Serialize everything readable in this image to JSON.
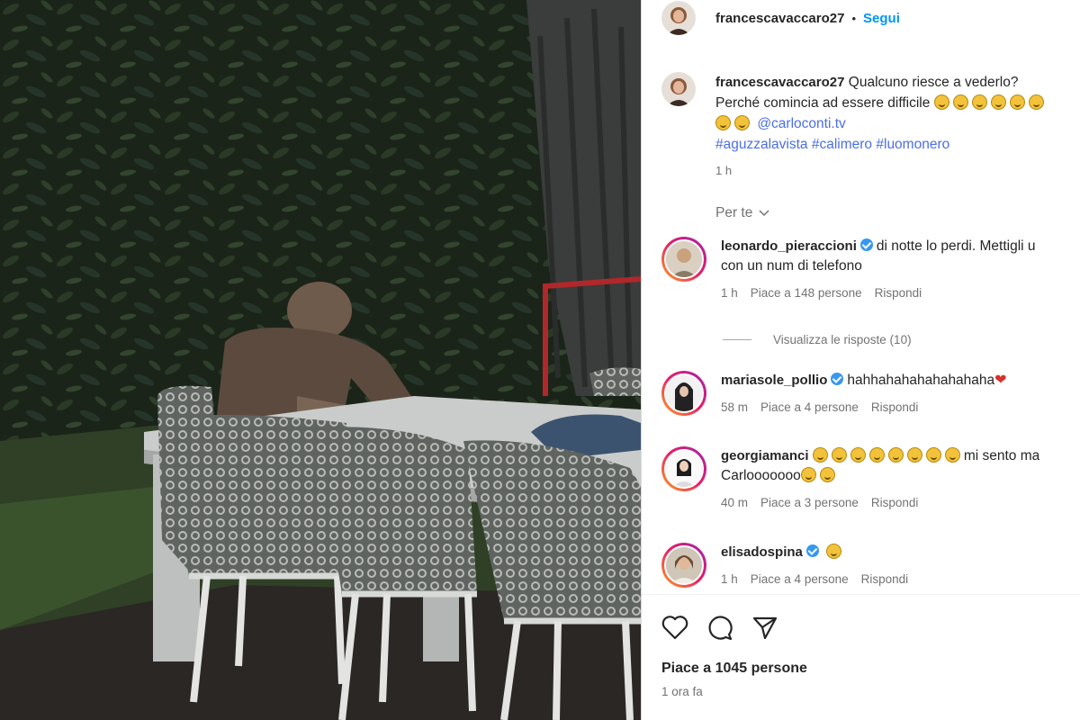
{
  "post": {
    "username": "francescavaccaro27",
    "separator": "•",
    "follow_label": "Segui"
  },
  "caption": {
    "username": "francescavaccaro27",
    "line1": "Qualcuno riesce a vederlo?",
    "line2": "Perché comincia ad essere difficile",
    "mention": "@carloconti.tv",
    "hashtags": [
      "#aguzzalavista",
      "#calimero",
      "#luomonero"
    ],
    "time": "1 h"
  },
  "filter": {
    "label": "Per te"
  },
  "comments": [
    {
      "username": "leonardo_pieraccioni",
      "verified": true,
      "text_line1": "di notte lo perdi. Mettigli u",
      "text_line2": "con un num di telefono",
      "time": "1 h",
      "likes": "Piace a 148 persone",
      "reply": "Rispondi",
      "view_replies": "Visualizza le risposte (10)"
    },
    {
      "username": "mariasole_pollio",
      "verified": true,
      "text_line1": "hahhahahahahahahaha",
      "time": "58 m",
      "likes": "Piace a 4 persone",
      "reply": "Rispondi"
    },
    {
      "username": "georgiamanci",
      "verified": false,
      "text_line1": "mi sento ma",
      "text_line2": "Carlooooooo",
      "time": "40 m",
      "likes": "Piace a 3 persone",
      "reply": "Rispondi"
    },
    {
      "username": "elisadospina",
      "verified": true,
      "time": "1 h",
      "likes": "Piace a 4 persone",
      "reply": "Rispondi"
    }
  ],
  "footer": {
    "likes": "Piace a 1045 persone",
    "time": "1 ora fa"
  },
  "icons": [
    "heart-icon",
    "comment-icon",
    "share-icon",
    "chevron-down-icon",
    "verified-icon"
  ],
  "colors": {
    "follow": "#0095f6",
    "link": "#4b6ee8",
    "meta": "#737373"
  }
}
